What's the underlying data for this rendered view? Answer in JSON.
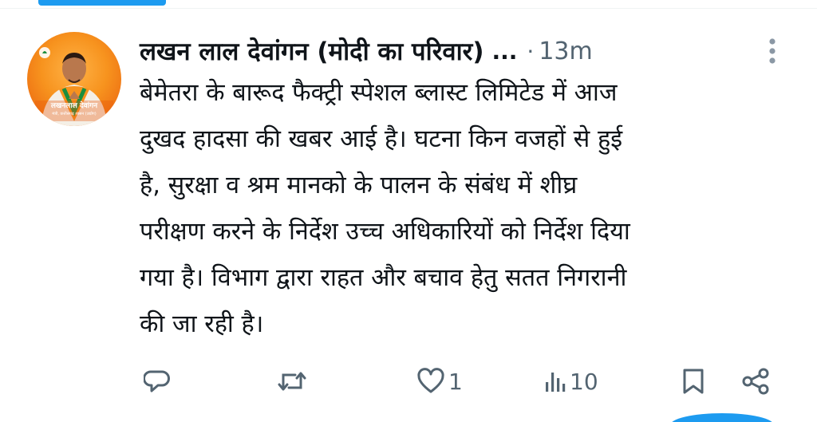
{
  "colors": {
    "accent": "#1d9bf0",
    "text_primary": "#0f1419",
    "text_secondary": "#536471"
  },
  "avatar": {
    "caption": "लखनलाल देवांगन",
    "subcaption": "मंत्री, छत्तीसगढ़ शासन (उद्योग)"
  },
  "tweet": {
    "author_name": "लखन लाल देवांगन (मोदी का परिवार)",
    "name_ellipsis": "...",
    "separator": "·",
    "timestamp": "13m",
    "text": "बेमेतरा के बारूद फैक्ट्री स्पेशल ब्लास्ट लिमिटेड में आज\nदुखद हादसा की खबर आई है। घटना किन वजहों से हुई\nहै, सुरक्षा व श्रम मानको के पालन के संबंध में शीघ्र\nपरीक्षण करने के निर्देश उच्च अधिकारियों को निर्देश दिया\nगया है। विभाग द्वारा राहत और बचाव हेतु सतत निगरानी\nकी जा रही है।"
  },
  "actions": {
    "reply": {
      "icon": "reply-icon",
      "count": ""
    },
    "retweet": {
      "icon": "retweet-icon",
      "count": ""
    },
    "like": {
      "icon": "heart-icon",
      "count": "1"
    },
    "views": {
      "icon": "views-icon",
      "count": "10"
    },
    "bookmark": {
      "icon": "bookmark-icon"
    },
    "share": {
      "icon": "share-icon"
    }
  }
}
